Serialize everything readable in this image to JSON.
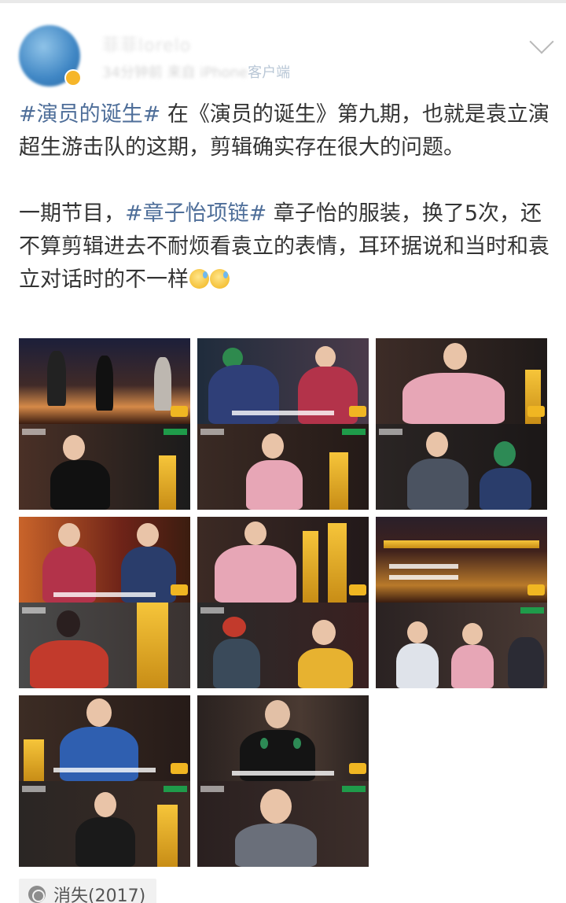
{
  "user": {
    "name": "菲菲lorelo",
    "time": "34分钟前",
    "from_prefix": "来自",
    "client_blurred": "iPhone",
    "client_suffix": "客户端"
  },
  "post": {
    "paragraph1": [
      {
        "type": "topic",
        "text": "#演员的诞生#"
      },
      {
        "type": "text",
        "text": " 在《演员的诞生》第九期，也就是袁立演超生游击队的这期，剪辑确实存在很大的问题。"
      }
    ],
    "paragraph2": [
      {
        "type": "text",
        "text": "一期节目，"
      },
      {
        "type": "topic",
        "text": "#章子怡项链#"
      },
      {
        "type": "text",
        "text": " 章子怡的服装，换了5次，还不算剪辑进去不耐烦看袁立的表情，耳环据说和当时和袁立对话时的不一样"
      }
    ],
    "emoji": [
      "sweat-emoji",
      "sweat-emoji"
    ]
  },
  "photos": {
    "count": 8,
    "colors": {
      "stage": "#3b1d10",
      "orange": "#d9772a",
      "seat": "#5a3c2c",
      "gold": "#e7b230",
      "pink": "#e7a6b6",
      "navy": "#2a3d6b",
      "green": "#2d8a55",
      "red": "#c23a2c"
    }
  },
  "location": {
    "icon": "location-icon",
    "label": "消失(2017)"
  }
}
